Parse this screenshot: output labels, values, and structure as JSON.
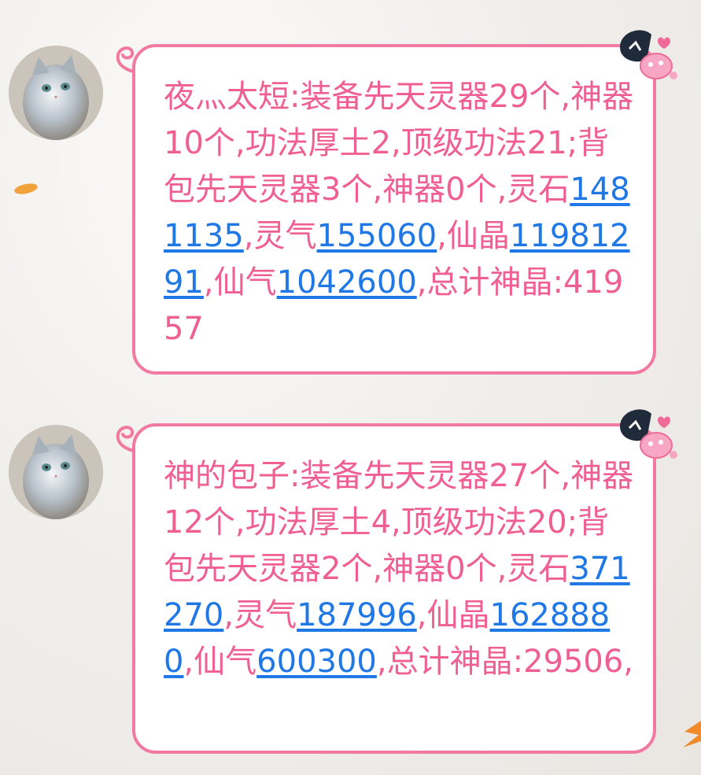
{
  "colors": {
    "bubble_border": "#f27aa2",
    "text": "#ef5f92",
    "link": "#1f78e6"
  },
  "messages": [
    {
      "sender": "夜灬太短",
      "colon": ":",
      "parts": [
        {
          "text": "装备先天灵器29个,神器10个,功法厚土2,顶级功法21;背包先天灵器3个,神器0个,灵石"
        },
        {
          "link": "1481135"
        },
        {
          "text": ",灵气"
        },
        {
          "link": "155060"
        },
        {
          "text": ",仙晶"
        },
        {
          "link": "11981291"
        },
        {
          "text": ",仙气"
        },
        {
          "link": "1042600"
        },
        {
          "text": ",总计神晶:41957"
        }
      ],
      "avatar_icon": "cat-avatar",
      "decoration_icon": "cartoon-mascot-icon"
    },
    {
      "sender": "神的包子",
      "colon": ":",
      "parts": [
        {
          "text": "装备先天灵器27个,神器12个,功法厚土4,顶级功法20;背包先天灵器2个,神器0个,灵石"
        },
        {
          "link": "371270"
        },
        {
          "text": ",灵气"
        },
        {
          "link": "187996"
        },
        {
          "text": ",仙晶"
        },
        {
          "link": "1628880"
        },
        {
          "text": ",仙气"
        },
        {
          "link": "600300"
        },
        {
          "text": ",总计神晶:29506,"
        }
      ],
      "avatar_icon": "cat-avatar",
      "decoration_icon": "cartoon-mascot-icon"
    }
  ]
}
